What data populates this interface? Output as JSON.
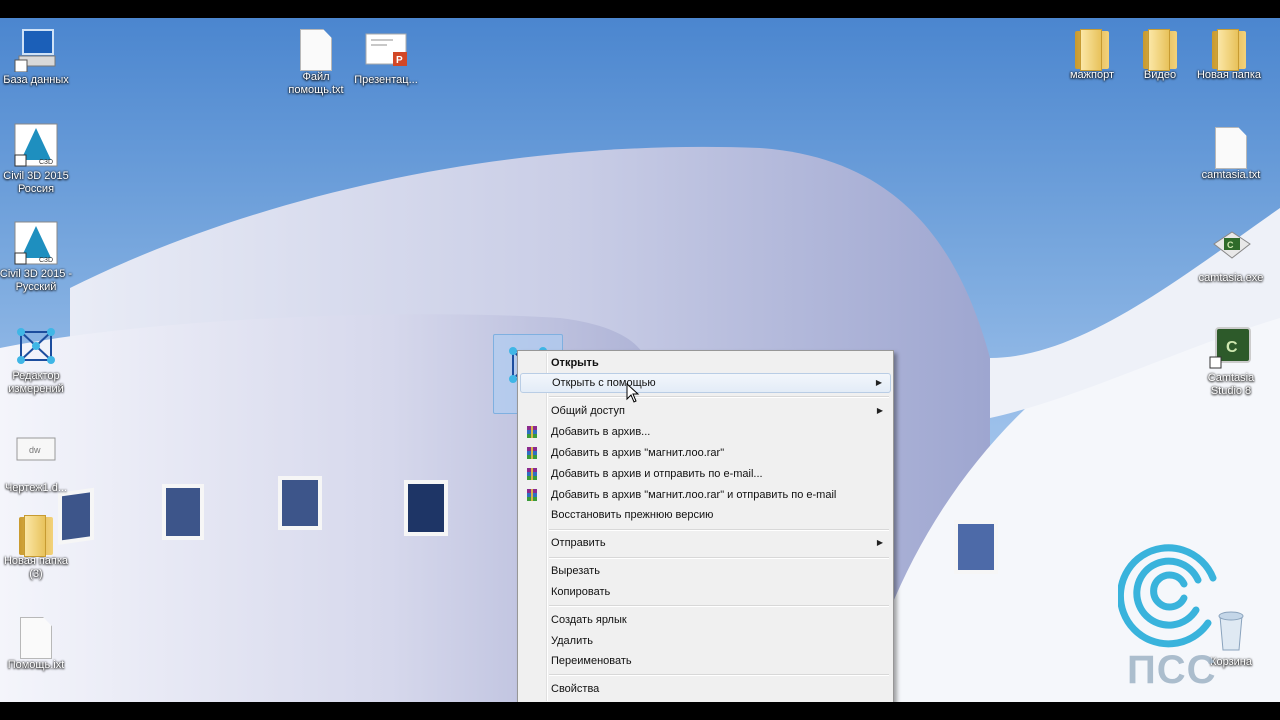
{
  "desktop_icons": [
    {
      "label": "База данных",
      "icon": "computer-database-icon"
    },
    {
      "label": "Civil 3D 2015 Россия",
      "icon": "civil3d-icon"
    },
    {
      "label": "Civil 3D 2015 - Русский",
      "icon": "civil3d-icon"
    },
    {
      "label": "Редактор измерений",
      "icon": "measurement-editor-icon"
    },
    {
      "label": "Чертеж1.d...",
      "icon": "drawing-file-icon"
    },
    {
      "label": "Новая папка (3)",
      "icon": "folder-icon"
    },
    {
      "label": "Помощь.ixt",
      "icon": "text-file-icon"
    },
    {
      "label": "Файл помощь.txt",
      "icon": "text-file-icon"
    },
    {
      "label": "Презентац...",
      "icon": "powerpoint-file-icon"
    },
    {
      "label": "мажпорт",
      "icon": "folder-icon"
    },
    {
      "label": "Видео",
      "icon": "video-folder-icon"
    },
    {
      "label": "Новая папка",
      "icon": "folder-icon"
    },
    {
      "label": "camtasia.txt",
      "icon": "text-file-icon"
    },
    {
      "label": "camtasia.exe",
      "icon": "camtasia-installer-icon"
    },
    {
      "label": "Camtasia Studio 8",
      "icon": "camtasia-icon"
    },
    {
      "label": "Корзина",
      "icon": "recycle-bin-icon"
    }
  ],
  "selected_icon": {
    "label": "магнит.лоо",
    "icon": "measurement-editor-icon"
  },
  "context_menu": {
    "items": [
      {
        "label": "Открыть",
        "bold": true
      },
      {
        "label": "Открыть с помощью",
        "submenu": true,
        "highlighted": true
      },
      {
        "label": "Общий доступ",
        "submenu": true
      },
      {
        "label": "Добавить в архив...",
        "icon": "winrar-icon"
      },
      {
        "label": "Добавить в архив \"магнит.лоо.rar\"",
        "icon": "winrar-icon"
      },
      {
        "label": "Добавить в архив и отправить по e-mail...",
        "icon": "winrar-icon"
      },
      {
        "label": "Добавить в архив \"магнит.лоо.rar\" и отправить по e-mail",
        "icon": "winrar-icon"
      },
      {
        "label": "Восстановить прежнюю версию"
      },
      {
        "label": "Отправить",
        "submenu": true
      },
      {
        "label": "Вырезать"
      },
      {
        "label": "Копировать"
      },
      {
        "label": "Создать ярлык"
      },
      {
        "label": "Удалить"
      },
      {
        "label": "Переименовать"
      },
      {
        "label": "Свойства"
      }
    ]
  },
  "watermark": {
    "text": "ПСС"
  },
  "colors": {
    "menu_bg": "#f0f0f0",
    "highlight_border": "#b9cde5",
    "label_text": "#ffffff"
  }
}
